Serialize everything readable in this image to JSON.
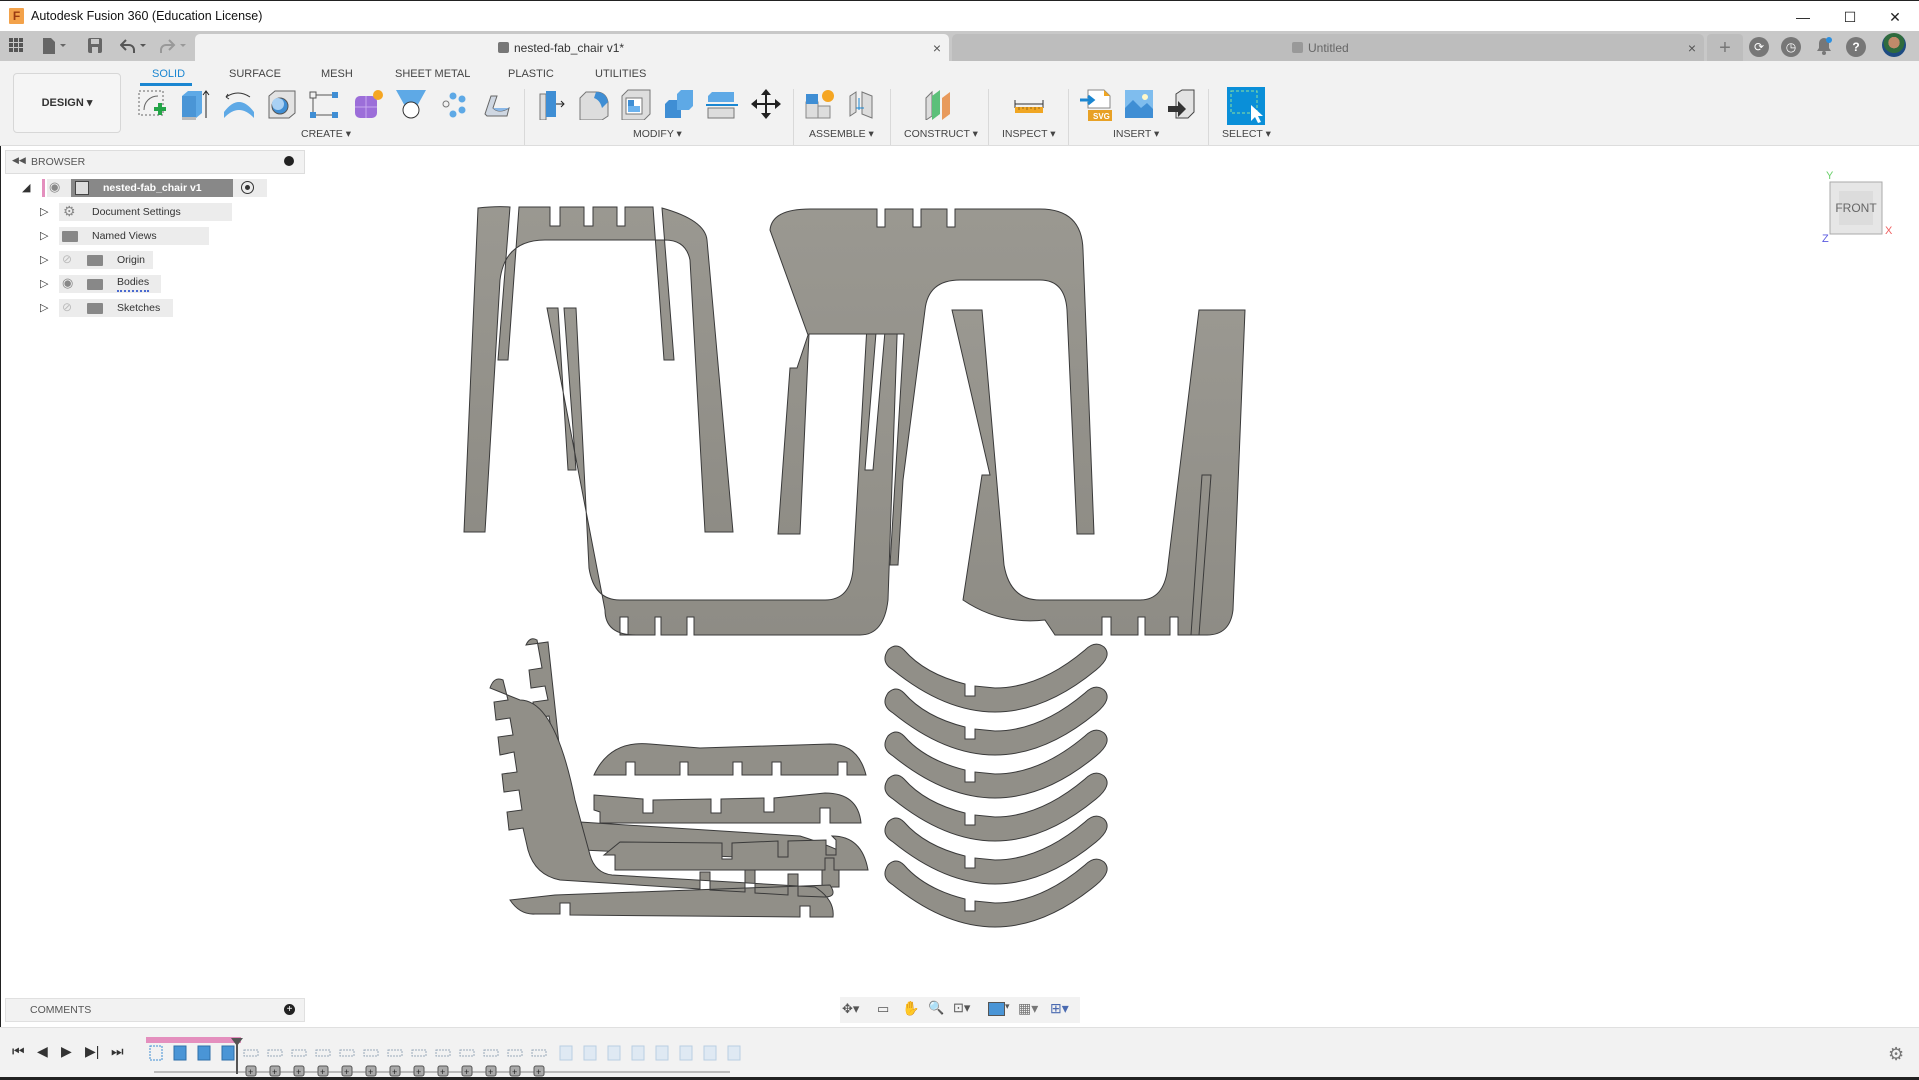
{
  "window": {
    "title": "Autodesk Fusion 360 (Education License)",
    "controls": {
      "minimize": "—",
      "maximize": "☐",
      "close": "✕"
    }
  },
  "quick_access": {
    "grid_icon": "▦",
    "file_icon": "🗎▾",
    "save_icon": "💾",
    "undo_icon": "↶▾",
    "redo_icon": "↷▾"
  },
  "tabs": [
    {
      "label": "nested-fab_chair v1*",
      "active": true,
      "close": "×"
    },
    {
      "label": "Untitled",
      "active": false,
      "close": "×"
    }
  ],
  "top_right": {
    "new_tab": "+",
    "jobs": "⟳",
    "clock": "◷",
    "notifications": "🔔",
    "help": "?"
  },
  "toolbar": {
    "workspace": "DESIGN ▾",
    "workspace_tabs": [
      "SOLID",
      "SURFACE",
      "MESH",
      "SHEET METAL",
      "PLASTIC",
      "UTILITIES"
    ],
    "active_tab": "SOLID",
    "groups": [
      {
        "label": "CREATE ▾",
        "tools": [
          "create-sketch",
          "extrude",
          "revolve",
          "hole",
          "rectangular-pattern",
          "create-form",
          "loft",
          "pattern",
          "rib"
        ]
      },
      {
        "label": "MODIFY ▾",
        "tools": [
          "press-pull",
          "fillet",
          "shell",
          "combine",
          "split-body",
          "move"
        ]
      },
      {
        "label": "ASSEMBLE ▾",
        "tools": [
          "new-component",
          "joint"
        ]
      },
      {
        "label": "CONSTRUCT ▾",
        "tools": [
          "offset-plane"
        ]
      },
      {
        "label": "INSPECT ▾",
        "tools": [
          "measure"
        ]
      },
      {
        "label": "INSERT ▾",
        "tools": [
          "insert-svg",
          "canvas",
          "insert-mesh"
        ]
      },
      {
        "label": "SELECT ▾",
        "tools": [
          "select"
        ]
      }
    ],
    "svg_badge": "SVG"
  },
  "browser": {
    "title": "BROWSER",
    "root": "nested-fab_chair v1",
    "items": [
      {
        "label": "Document Settings",
        "icon": "gear",
        "visible": null
      },
      {
        "label": "Named Views",
        "icon": "folder",
        "visible": null
      },
      {
        "label": "Origin",
        "icon": "folder",
        "visible": false
      },
      {
        "label": "Bodies",
        "icon": "folder",
        "visible": true
      },
      {
        "label": "Sketches",
        "icon": "folder",
        "visible": false
      }
    ]
  },
  "viewcube": {
    "face": "FRONT",
    "axes": {
      "x": "X",
      "y": "Y",
      "z": "Z"
    }
  },
  "comments": {
    "title": "COMMENTS"
  },
  "navbar": [
    "orbit",
    "look-at",
    "pan",
    "zoom",
    "fit",
    "display-settings",
    "grid",
    "viewports"
  ],
  "timeline": {
    "controls": [
      "⏮",
      "◀",
      "▶",
      "▶|",
      "⏭"
    ],
    "features_before_marker": 4,
    "grouped_features": 13,
    "features_after_marker": 8
  },
  "colors": {
    "accent": "#1a86d1",
    "part_fill": "#918f88",
    "part_stroke": "#3a3a3a",
    "select_blue": "#0a8fd8",
    "component_pink": "#e48fbe"
  }
}
